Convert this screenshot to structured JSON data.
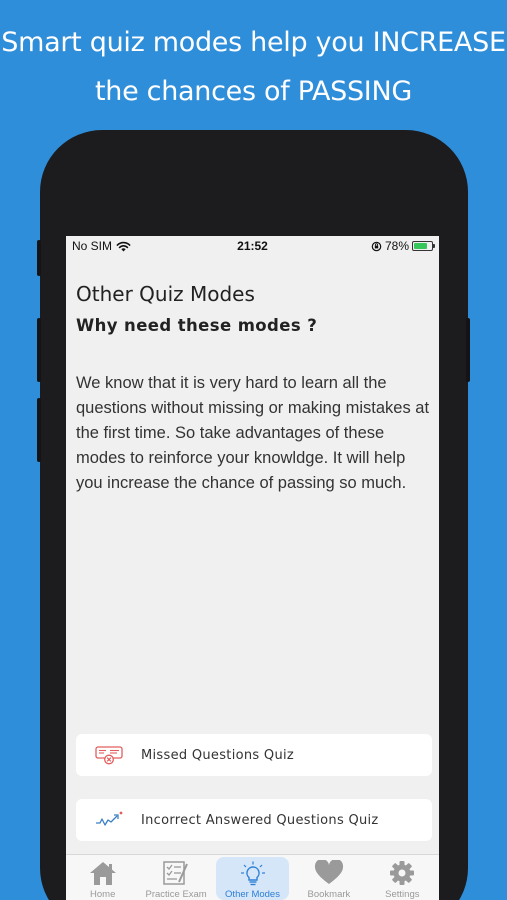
{
  "headline": {
    "line1": "Smart quiz modes help you INCREASE",
    "line2": "the chances of PASSING"
  },
  "status_bar": {
    "carrier": "No SIM",
    "time": "21:52",
    "battery_percent": "78%",
    "battery_level": 0.78
  },
  "page": {
    "title": "Other Quiz Modes",
    "subtitle": "Why need these modes ?",
    "body": "We know that it is very hard to learn all the questions without missing or making mistakes at the first time. So take advantages of these modes to reinforce your knowldge. It will help you increase the chance of passing so much."
  },
  "modes": [
    {
      "label": "Missed Questions Quiz",
      "icon": "missed-questions-icon"
    },
    {
      "label": "Incorrect Answered Questions Quiz",
      "icon": "trend-graph-icon"
    }
  ],
  "tabs": [
    {
      "label": "Home",
      "icon": "home-icon",
      "active": false
    },
    {
      "label": "Practice Exam",
      "icon": "exam-icon",
      "active": false
    },
    {
      "label": "Other Modes",
      "icon": "lightbulb-icon",
      "active": true
    },
    {
      "label": "Bookmark",
      "icon": "heart-icon",
      "active": false
    },
    {
      "label": "Settings",
      "icon": "gear-icon",
      "active": false
    }
  ],
  "colors": {
    "background": "#2f8ed9",
    "accent": "#2f7fd6",
    "active_tab_bg": "#d4e6f8",
    "missed_icon": "#e35d5d"
  }
}
